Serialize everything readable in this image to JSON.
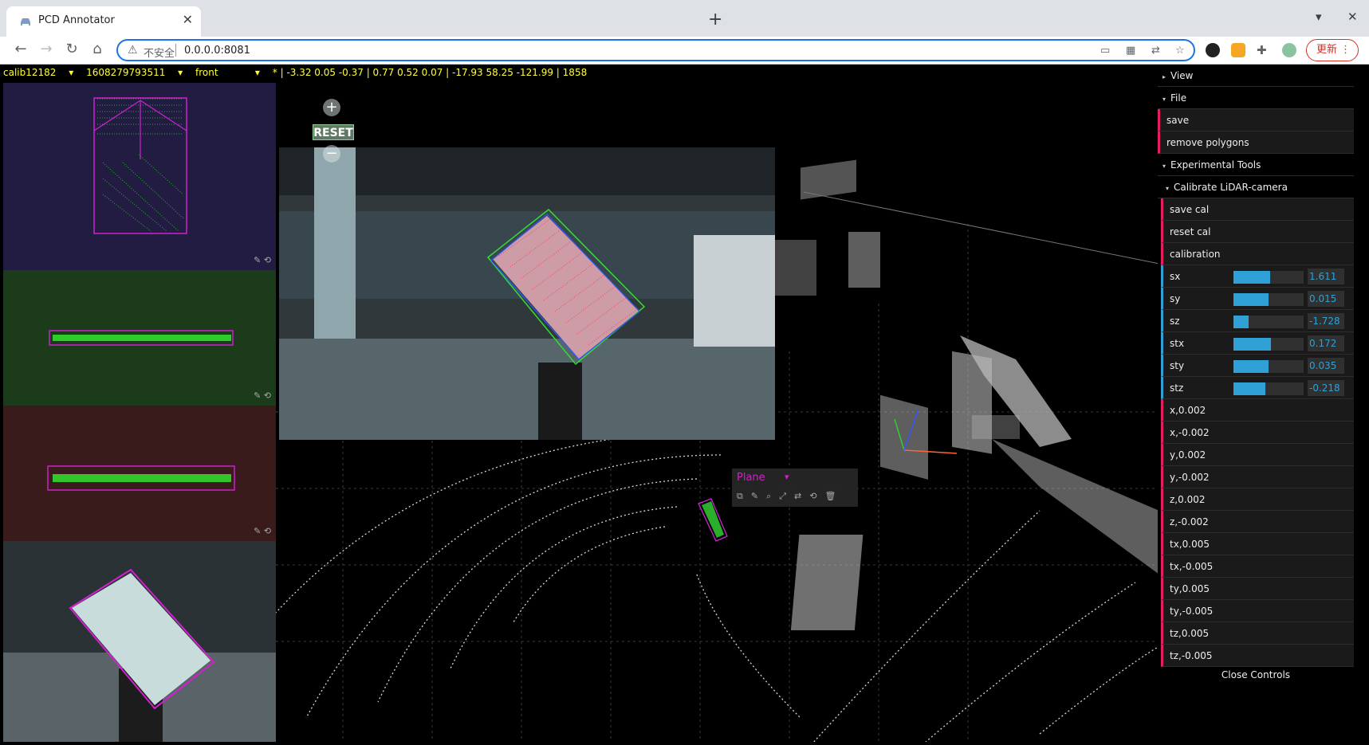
{
  "browser": {
    "tab_title": "PCD Annotator",
    "tab_close": "✕",
    "new_tab": "+",
    "security_label": "不安全",
    "url": "0.0.0.0:8081",
    "update_label": "更新",
    "nav": {
      "back": "←",
      "forward": "→",
      "reload": "↻",
      "home": "⌂"
    }
  },
  "status": {
    "scene": "calib12182",
    "frame": "1608279793511",
    "camera": "front",
    "info": "* | -3.32 0.05 -0.37 | 0.77 0.52 0.07 | -17.93 58.25 -121.99 | 1858"
  },
  "image_controls": {
    "zoom_in": "+",
    "reset": "RESET",
    "zoom_out": "−"
  },
  "object_menu": {
    "type": "Plane"
  },
  "gui": {
    "folders": {
      "view": "View",
      "file": "File",
      "experimental": "Experimental Tools",
      "calibrate": "Calibrate LiDAR-camera"
    },
    "file_items": [
      "save",
      "remove polygons"
    ],
    "cal_items": [
      "save cal",
      "reset cal",
      "calibration"
    ],
    "sliders": [
      {
        "label": "sx",
        "value": "1.611",
        "level": 0.52
      },
      {
        "label": "sy",
        "value": "0.015",
        "level": 0.5
      },
      {
        "label": "sz",
        "value": "-1.728",
        "level": 0.22
      },
      {
        "label": "stx",
        "value": "0.172",
        "level": 0.53
      },
      {
        "label": "sty",
        "value": "0.035",
        "level": 0.5
      },
      {
        "label": "stz",
        "value": "-0.218",
        "level": 0.45
      }
    ],
    "step_items": [
      "x,0.002",
      "x,-0.002",
      "y,0.002",
      "y,-0.002",
      "z,0.002",
      "z,-0.002",
      "tx,0.005",
      "tx,-0.005",
      "ty,0.005",
      "ty,-0.005",
      "tz,0.005",
      "tz,-0.005"
    ],
    "close_controls": "Close Controls"
  },
  "colors": {
    "accent_blue": "#2fa1d6",
    "accent_red": "#e61d5f",
    "status_yellow": "#ffff33",
    "box_magenta": "#d020d0",
    "points_green": "#33ff33"
  }
}
